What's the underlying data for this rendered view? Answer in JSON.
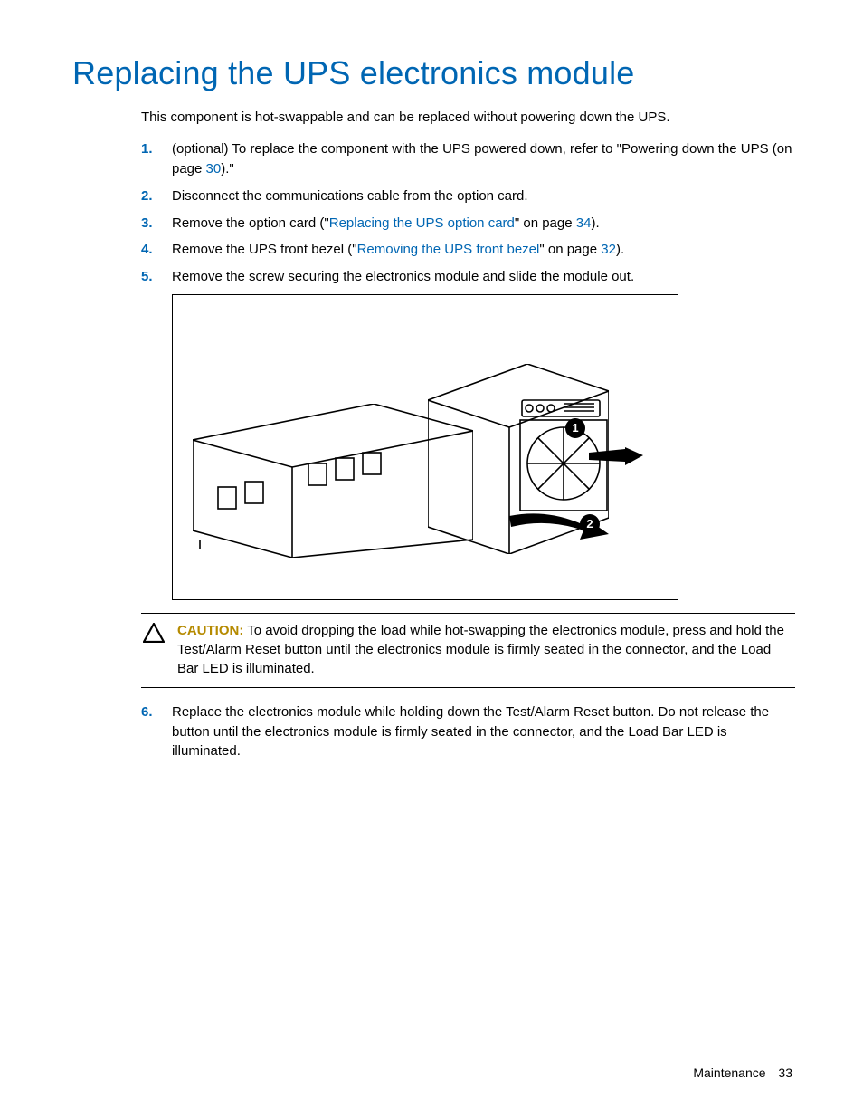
{
  "title": "Replacing the UPS electronics module",
  "intro": "This component is hot-swappable and can be replaced without powering down the UPS.",
  "steps": [
    {
      "num": "1.",
      "parts": [
        {
          "t": "text",
          "v": "(optional) To replace the component with the UPS powered down, refer to \"Powering down the UPS (on page "
        },
        {
          "t": "link",
          "v": "30"
        },
        {
          "t": "text",
          "v": ").\""
        }
      ]
    },
    {
      "num": "2.",
      "parts": [
        {
          "t": "text",
          "v": "Disconnect the communications cable from the option card."
        }
      ]
    },
    {
      "num": "3.",
      "parts": [
        {
          "t": "text",
          "v": "Remove the option card (\""
        },
        {
          "t": "link",
          "v": "Replacing the UPS option card"
        },
        {
          "t": "text",
          "v": "\" on page "
        },
        {
          "t": "link",
          "v": "34"
        },
        {
          "t": "text",
          "v": ")."
        }
      ]
    },
    {
      "num": "4.",
      "parts": [
        {
          "t": "text",
          "v": "Remove the UPS front bezel (\""
        },
        {
          "t": "link",
          "v": "Removing the UPS front bezel"
        },
        {
          "t": "text",
          "v": "\" on page "
        },
        {
          "t": "link",
          "v": "32"
        },
        {
          "t": "text",
          "v": ")."
        }
      ]
    },
    {
      "num": "5.",
      "parts": [
        {
          "t": "text",
          "v": "Remove the screw securing the electronics module and slide the module out."
        }
      ]
    }
  ],
  "figure": {
    "callouts": [
      "1",
      "2"
    ]
  },
  "caution": {
    "label": "CAUTION:",
    "text": "To avoid dropping the load while hot-swapping the electronics module, press and hold the Test/Alarm Reset button until the electronics module is firmly seated in the connector, and the Load Bar LED is illuminated."
  },
  "steps_after": [
    {
      "num": "6.",
      "parts": [
        {
          "t": "text",
          "v": "Replace the electronics module while holding down the Test/Alarm Reset button. Do not release the button until the electronics module is firmly seated in the connector, and the Load Bar LED is illuminated."
        }
      ]
    }
  ],
  "footer": {
    "section": "Maintenance",
    "page": "33"
  }
}
